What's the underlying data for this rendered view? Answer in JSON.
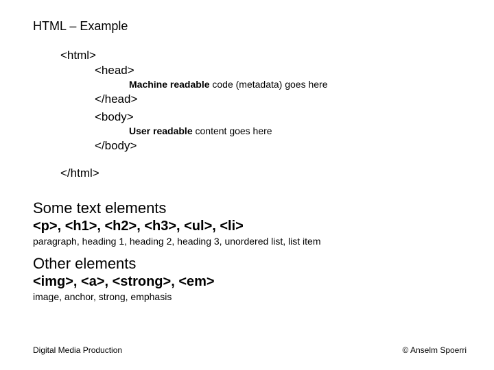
{
  "title": "HTML – Example",
  "code": {
    "html_open": "<html>",
    "head_open": "<head>",
    "head_note_bold": "Machine readable",
    "head_note_rest": " code (metadata) goes here",
    "head_close": "</head>",
    "body_open": "<body>",
    "body_note_bold": "User readable",
    "body_note_rest": " content goes here",
    "body_close": "</body>",
    "html_close": "</html>"
  },
  "section1": {
    "title": "Some text elements",
    "tags": "<p>, <h1>, <h2>, <h3>, <ul>, <li>",
    "desc": "paragraph, heading 1, heading 2, heading 3, unordered list, list item"
  },
  "section2": {
    "title": "Other elements",
    "tags": "<img>, <a>, <strong>, <em>",
    "desc": "image, anchor, strong, emphasis"
  },
  "footer": {
    "left": "Digital Media Production",
    "right": "© Anselm Spoerri"
  }
}
